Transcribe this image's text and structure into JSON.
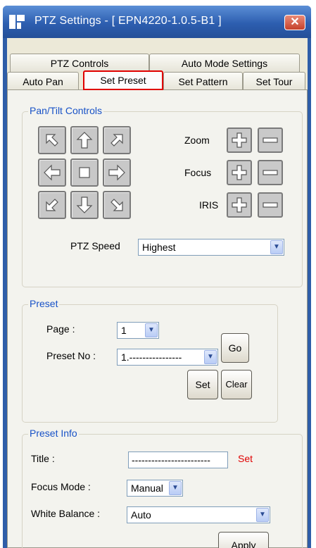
{
  "window": {
    "title": "PTZ Settings - [ EPN4220-1.0.5-B1 ]",
    "close_glyph": "✕"
  },
  "tabs": {
    "row_top": [
      {
        "label": "PTZ Controls"
      },
      {
        "label": "Auto Mode Settings"
      }
    ],
    "row_bottom": [
      {
        "label": "Auto Pan"
      },
      {
        "label": "Set Preset",
        "active": true
      },
      {
        "label": "Set Pattern"
      },
      {
        "label": "Set Tour"
      }
    ]
  },
  "pan_tilt": {
    "legend": "Pan/Tilt Controls",
    "zoom_label": "Zoom",
    "focus_label": "Focus",
    "iris_label": "IRIS",
    "speed_label": "PTZ Speed",
    "speed_value": "Highest"
  },
  "preset": {
    "legend": "Preset",
    "page_label": "Page :",
    "page_value": "1",
    "preset_no_label": "Preset No :",
    "preset_no_value": "1.----------------",
    "go_label": "Go",
    "set_label": "Set",
    "clear_label": "Clear"
  },
  "preset_info": {
    "legend": "Preset Info",
    "title_label": "Title :",
    "title_value": "------------------------",
    "title_set_link": "Set",
    "focus_mode_label": "Focus Mode :",
    "focus_mode_value": "Manual",
    "white_balance_label": "White Balance :",
    "white_balance_value": "Auto",
    "apply_label": "Apply"
  },
  "colors": {
    "accent": "#1852c7",
    "highlight": "#e00000",
    "titlebar": "#2d5eb0"
  },
  "icons": [
    "app-icon",
    "close-icon",
    "arrow-up-left-icon",
    "arrow-up-icon",
    "arrow-up-right-icon",
    "arrow-left-icon",
    "stop-icon",
    "arrow-right-icon",
    "arrow-down-left-icon",
    "arrow-down-icon",
    "arrow-down-right-icon",
    "plus-icon",
    "minus-icon",
    "chevron-down-icon"
  ]
}
